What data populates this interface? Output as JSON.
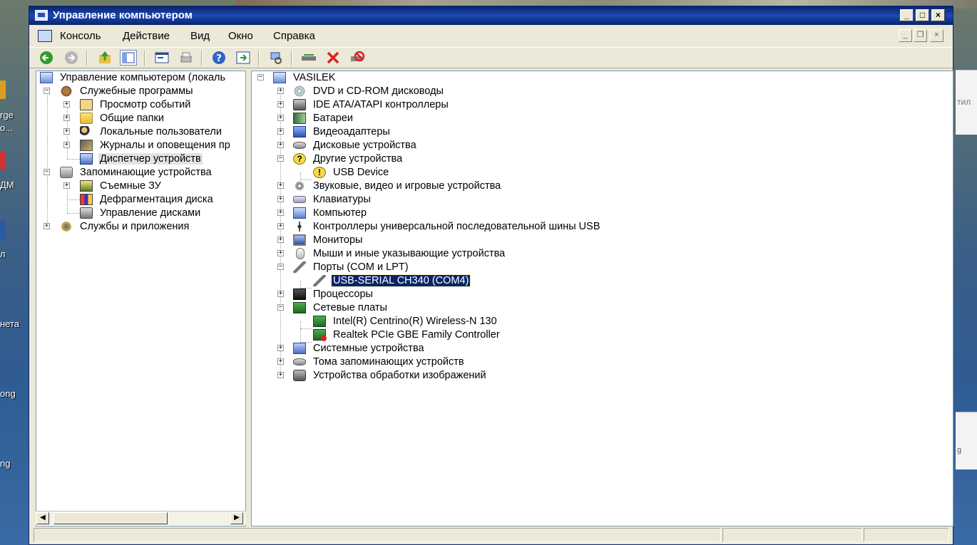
{
  "window": {
    "title": "Управление компьютером",
    "controls": {
      "minimize": "_",
      "maximize": "□",
      "close": "×"
    }
  },
  "menu": {
    "items": [
      "Консоль",
      "Действие",
      "Вид",
      "Окно",
      "Справка"
    ],
    "mdi_controls": {
      "minimize": "_",
      "restore": "❐",
      "close": "×"
    }
  },
  "toolbar": {
    "buttons": [
      "back-icon",
      "forward-icon",
      "up-icon",
      "show-hide-tree-icon",
      "properties-icon",
      "print-icon",
      "help-icon",
      "export-icon",
      "scan-hardware-icon",
      "update-driver-icon",
      "uninstall-icon",
      "disable-icon"
    ]
  },
  "tree": {
    "root": "Управление компьютером (локаль",
    "system_tools": "Служебные программы",
    "event_viewer": "Просмотр событий",
    "shared_folders": "Общие папки",
    "local_users": "Локальные пользователи",
    "logs_alerts": "Журналы и оповещения пр",
    "device_manager": "Диспетчер устройств",
    "storage": "Запоминающие устройства",
    "removable": "Съемные ЗУ",
    "defrag": "Дефрагментация диска",
    "disk_mgmt": "Управление дисками",
    "services_apps": "Службы и приложения"
  },
  "devices": {
    "root": "VASILEK",
    "dvd": "DVD и CD-ROM дисководы",
    "ide": "IDE ATA/ATAPI контроллеры",
    "batteries": "Батареи",
    "video": "Видеоадаптеры",
    "disks": "Дисковые устройства",
    "other": "Другие устройства",
    "usb_device": "USB Device",
    "sound": "Звуковые, видео и игровые устройства",
    "keyboards": "Клавиатуры",
    "computer": "Компьютер",
    "usb_controllers": "Контроллеры универсальной последовательной шины USB",
    "monitors": "Мониторы",
    "mice": "Мыши и иные указывающие устройства",
    "ports": "Порты (COM и LPT)",
    "usb_serial": "USB-SERIAL CH340 (COM4)",
    "processors": "Процессоры",
    "network": "Сетевые платы",
    "intel_wifi": "Intel(R) Centrino(R) Wireless-N 130",
    "realtek": "Realtek PCIe GBE Family Controller",
    "system": "Системные устройства",
    "volumes": "Тома запоминающих устройств",
    "imaging": "Устройства обработки изображений"
  },
  "desktop": {
    "labels": [
      "rge",
      "o...",
      "ДМ",
      "л",
      "нета",
      "ong",
      "ng"
    ],
    "right_text": "тил",
    "right_text2": "g"
  },
  "expanders": {
    "plus": "+",
    "minus": "−"
  },
  "scroll": {
    "left": "◀",
    "right": "▶"
  },
  "colors": {
    "titlebar": "#0a246a",
    "selection": "#0a246a",
    "window_bg": "#ece9d8"
  }
}
